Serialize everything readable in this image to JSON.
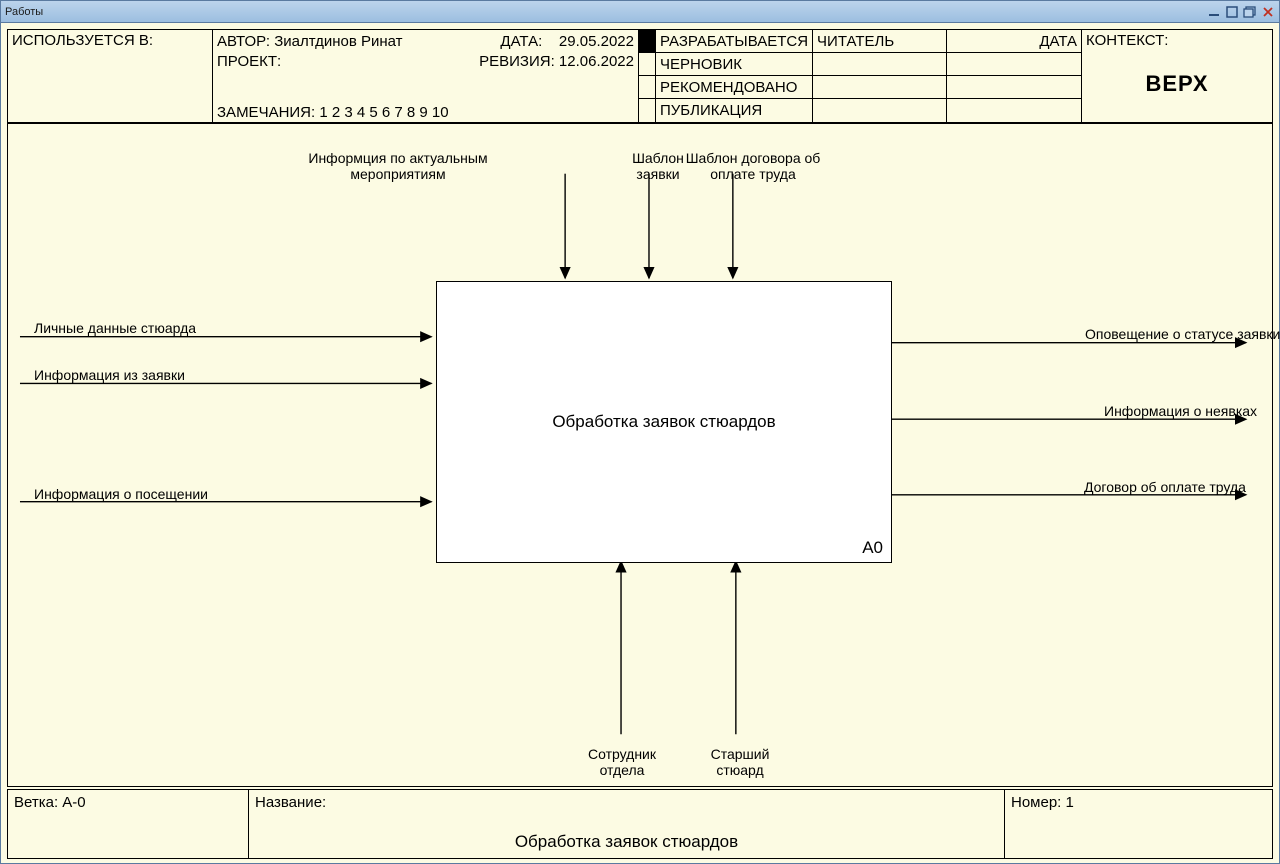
{
  "window_title": "Работы",
  "header": {
    "used_in": "ИСПОЛЬЗУЕТСЯ В:",
    "author_label": "АВТОР:",
    "author_value": "Зиалтдинов Ринат",
    "project_label": "ПРОЕКТ:",
    "date_label": "ДАТА:",
    "date_value": "29.05.2022",
    "revision_label": "РЕВИЗИЯ:",
    "revision_value": "12.06.2022",
    "notes_label": "ЗАМЕЧАНИЯ: 1 2 3 4 5 6 7 8 9 10",
    "status_developing": "РАЗРАБАТЫВАЕТСЯ",
    "status_draft": "ЧЕРНОВИК",
    "status_recommended": "РЕКОМЕНДОВАНО",
    "status_publication": "ПУБЛИКАЦИЯ",
    "reader_label": "ЧИТАТЕЛЬ",
    "date2_label": "ДАТА",
    "context_label": "КОНТЕКСТ:",
    "context_top": "ВЕРХ"
  },
  "diagram": {
    "process_title": "Обработка заявок стюардов",
    "process_id": "А0",
    "controls": {
      "info_events": "Информция по актуальным\nмероприятиям",
      "template_req": "Шаблон\nзаявки",
      "template_pay": "Шаблон договора об\nоплате труда"
    },
    "inputs": {
      "personal": "Личные данные стюарда",
      "req_info": "Информация из заявки",
      "attendance": "Информация о посещении"
    },
    "outputs": {
      "status_notify": "Оповещение о статусе заявки",
      "absence": "Информация о неявках",
      "pay_contract": "Договор об оплате труда"
    },
    "mechanisms": {
      "employee": "Сотрудник\nотдела",
      "senior": "Старший\nстюард"
    }
  },
  "footer": {
    "branch_label": "Ветка:",
    "branch_value": "А-0",
    "name_label": "Название:",
    "name_value": "Обработка заявок стюардов",
    "number_label": "Номер:",
    "number_value": "1"
  }
}
